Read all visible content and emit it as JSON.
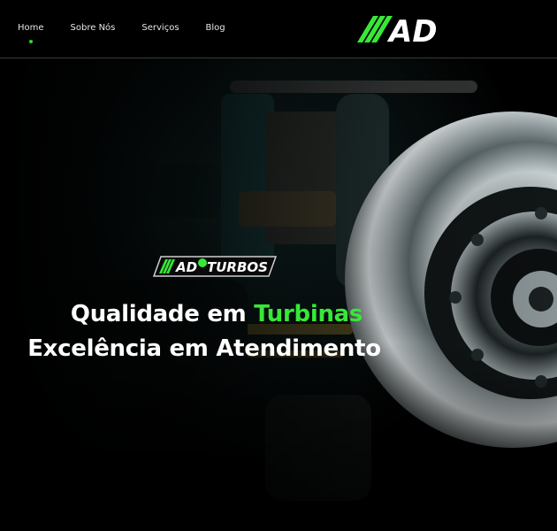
{
  "nav": {
    "items": [
      {
        "label": "Home",
        "active": true
      },
      {
        "label": "Sobre Nós",
        "active": false
      },
      {
        "label": "Serviços",
        "active": false
      },
      {
        "label": "Blog",
        "active": false
      }
    ]
  },
  "brand": {
    "logo_text": "AD",
    "badge_text_ad": "AD",
    "badge_text_turbos": "TURBOS"
  },
  "hero": {
    "headline_part1": "Qualidade em",
    "headline_accent": "Turbinas",
    "headline_line2": "Excelência em Atendimento",
    "background": "turbocharger-photo"
  },
  "colors": {
    "accent": "#37e837",
    "background": "#000000",
    "text": "#ffffff"
  }
}
